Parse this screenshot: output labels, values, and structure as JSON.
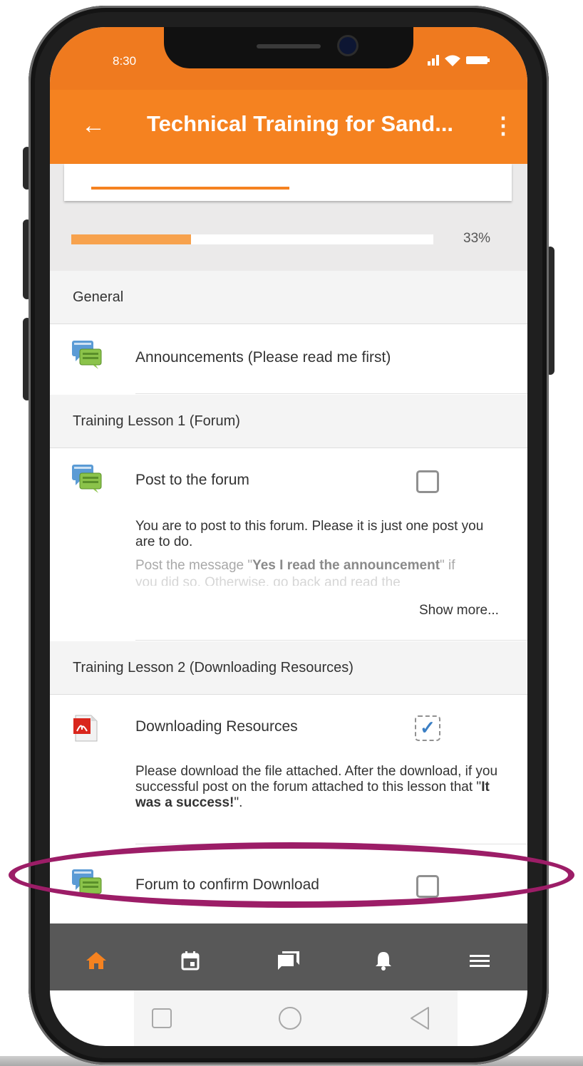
{
  "status_bar": {
    "time": "8:30",
    "icons": [
      "signal-icon",
      "wifi-icon",
      "battery-icon"
    ]
  },
  "app_bar": {
    "back_icon": "arrow-left-icon",
    "title": "Technical Training for Sand...",
    "menu_icon": "more-vert-icon"
  },
  "progress": {
    "percent_label": "33%",
    "fraction": 0.33
  },
  "sections": [
    {
      "title": "General",
      "activities": [
        {
          "icon": "forum-icon",
          "name": "Announcements (Please read me first)"
        }
      ]
    },
    {
      "title": "Training Lesson 1 (Forum)",
      "activities": [
        {
          "icon": "forum-icon",
          "name": "Post to the forum",
          "completion": "manual-unchecked",
          "description": "You are to post to this forum. Please it is just one post you are to do.",
          "description_fade_prefix": "Post the message \"",
          "description_fade_bold": "Yes I read the announcement",
          "description_fade_suffix": "\" if",
          "description_fade_line2": "you did so. Otherwise, go back and read the",
          "show_more": "Show more..."
        }
      ]
    },
    {
      "title": "Training Lesson 2 (Downloading Resources)",
      "activities": [
        {
          "icon": "pdf-icon",
          "name": "Downloading Resources",
          "completion": "auto-checked",
          "description_prefix": "Please download the file attached. After the download, if you successful post on the forum attached to this lesson that \"",
          "description_bold": "It was a success!",
          "description_suffix": "\"."
        },
        {
          "icon": "forum-icon",
          "name": "Forum to confirm Download",
          "completion": "manual-unchecked"
        }
      ]
    }
  ],
  "bottom_nav": {
    "items": [
      "home-icon",
      "calendar-icon",
      "messages-icon",
      "notifications-icon",
      "menu-icon"
    ],
    "active": "home-icon",
    "active_color": "#f58220"
  },
  "system_nav": {
    "items": [
      "recents-icon",
      "home-circle-icon",
      "back-triangle-icon"
    ]
  },
  "colors": {
    "brand": "#f58220",
    "highlight": "#9c1d67",
    "progress": "#f7a24d"
  }
}
